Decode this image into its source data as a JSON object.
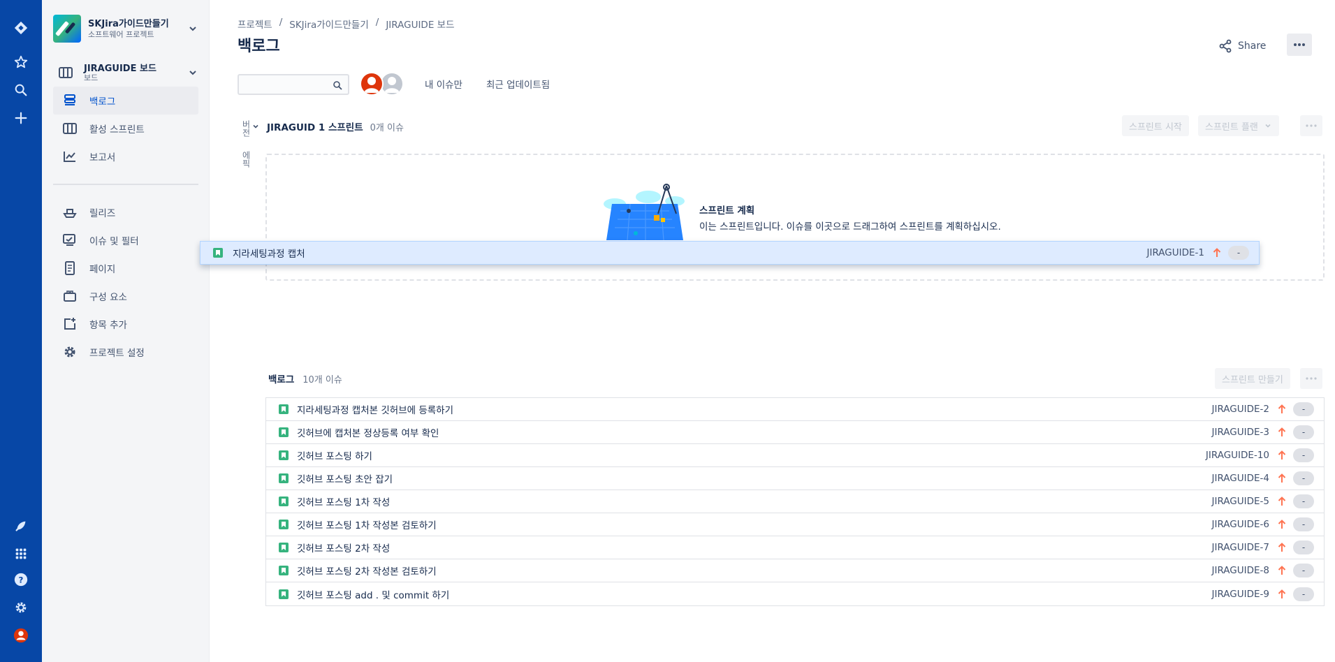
{
  "sidebar": {
    "project_name": "SKJira가이드만들기",
    "project_type": "소프트웨어 프로젝트",
    "board_name": "JIRAGUIDE 보드",
    "board_type": "보드",
    "nav_top": [
      {
        "label": "백로그",
        "icon": "backlog-icon",
        "active": true
      },
      {
        "label": "활성 스프린트",
        "icon": "board-columns-icon",
        "active": false
      },
      {
        "label": "보고서",
        "icon": "chart-line-icon",
        "active": false
      }
    ],
    "nav_bottom": [
      {
        "label": "릴리즈",
        "icon": "ship-icon"
      },
      {
        "label": "이슈 및 필터",
        "icon": "issues-filter-icon"
      },
      {
        "label": "페이지",
        "icon": "page-icon"
      },
      {
        "label": "구성 요소",
        "icon": "component-icon"
      },
      {
        "label": "항목 추가",
        "icon": "add-item-icon"
      },
      {
        "label": "프로젝트 설정",
        "icon": "gear-icon"
      }
    ]
  },
  "breadcrumb": [
    "프로젝트",
    "SKJira가이드만들기",
    "JIRAGUIDE 보드"
  ],
  "page_title": "백로그",
  "header": {
    "share_label": "Share"
  },
  "filters": {
    "search_placeholder": "",
    "quick_filters": [
      "내 이슈만",
      "최근 업데이트됨"
    ]
  },
  "side_labels": {
    "version": "버전",
    "epic": "에픽"
  },
  "sprint": {
    "name": "JIRAGUID 1 스프린트",
    "count": "0개 이슈",
    "start_label": "스프린트 시작",
    "plan_label": "스프린트 플랜",
    "empty_title": "스프린트 계획",
    "empty_desc": "이는 스프린트입니다. 이슈를 이곳으로 드래그하여 스프린트를 계획하십시오."
  },
  "dragged_issue": {
    "summary": "지라세팅과정 캡처",
    "key": "JIRAGUIDE-1",
    "estimate": "-"
  },
  "backlog": {
    "name": "백로그",
    "count": "10개 이슈",
    "create_sprint_label": "스프린트 만들기",
    "issues": [
      {
        "summary": "지라세팅과정 캡처본 깃허브에 등록하기",
        "key": "JIRAGUIDE-2",
        "estimate": "-"
      },
      {
        "summary": "깃허브에 캡처본 정상등록 여부 확인",
        "key": "JIRAGUIDE-3",
        "estimate": "-"
      },
      {
        "summary": "깃허브 포스팅 하기",
        "key": "JIRAGUIDE-10",
        "estimate": "-"
      },
      {
        "summary": "깃허브 포스팅 초안 잡기",
        "key": "JIRAGUIDE-4",
        "estimate": "-"
      },
      {
        "summary": "깃허브 포스팅 1차 작성",
        "key": "JIRAGUIDE-5",
        "estimate": "-"
      },
      {
        "summary": "깃허브 포스팅 1차 작성본 검토하기",
        "key": "JIRAGUIDE-6",
        "estimate": "-"
      },
      {
        "summary": "깃허브 포스팅 2차 작성",
        "key": "JIRAGUIDE-7",
        "estimate": "-"
      },
      {
        "summary": "깃허브 포스팅 2차 작성본 검토하기",
        "key": "JIRAGUIDE-8",
        "estimate": "-"
      },
      {
        "summary": "깃허브 포스팅 add . 및 commit 하기",
        "key": "JIRAGUIDE-9",
        "estimate": "-"
      }
    ]
  },
  "colors": {
    "global_nav": "#0747a6",
    "priority": "#ff7452",
    "story": "#36b37e",
    "drag_bg": "#deebff"
  }
}
